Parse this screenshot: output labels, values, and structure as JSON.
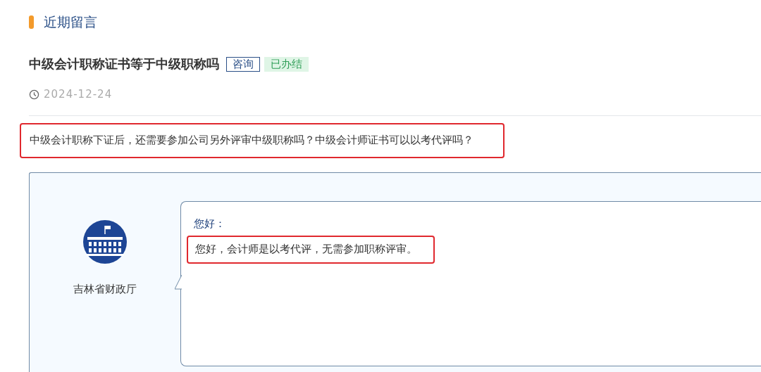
{
  "section_title": "近期留言",
  "message": {
    "title": "中级会计职称证书等于中级职称吗",
    "tags": [
      {
        "label": "咨询",
        "kind": "category"
      },
      {
        "label": "已办结",
        "kind": "status"
      }
    ],
    "date": "2024-12-24",
    "question": "中级会计职称下证后，还需要参加公司另外评审中级职称吗？中级会计师证书可以以考代评吗？",
    "question_highlighted": true
  },
  "reply": {
    "author": "吉林省财政厅",
    "greeting": "您好：",
    "answer": "您好，会计师是以考代评，无需参加职称评审。",
    "answer_highlighted": true
  }
}
